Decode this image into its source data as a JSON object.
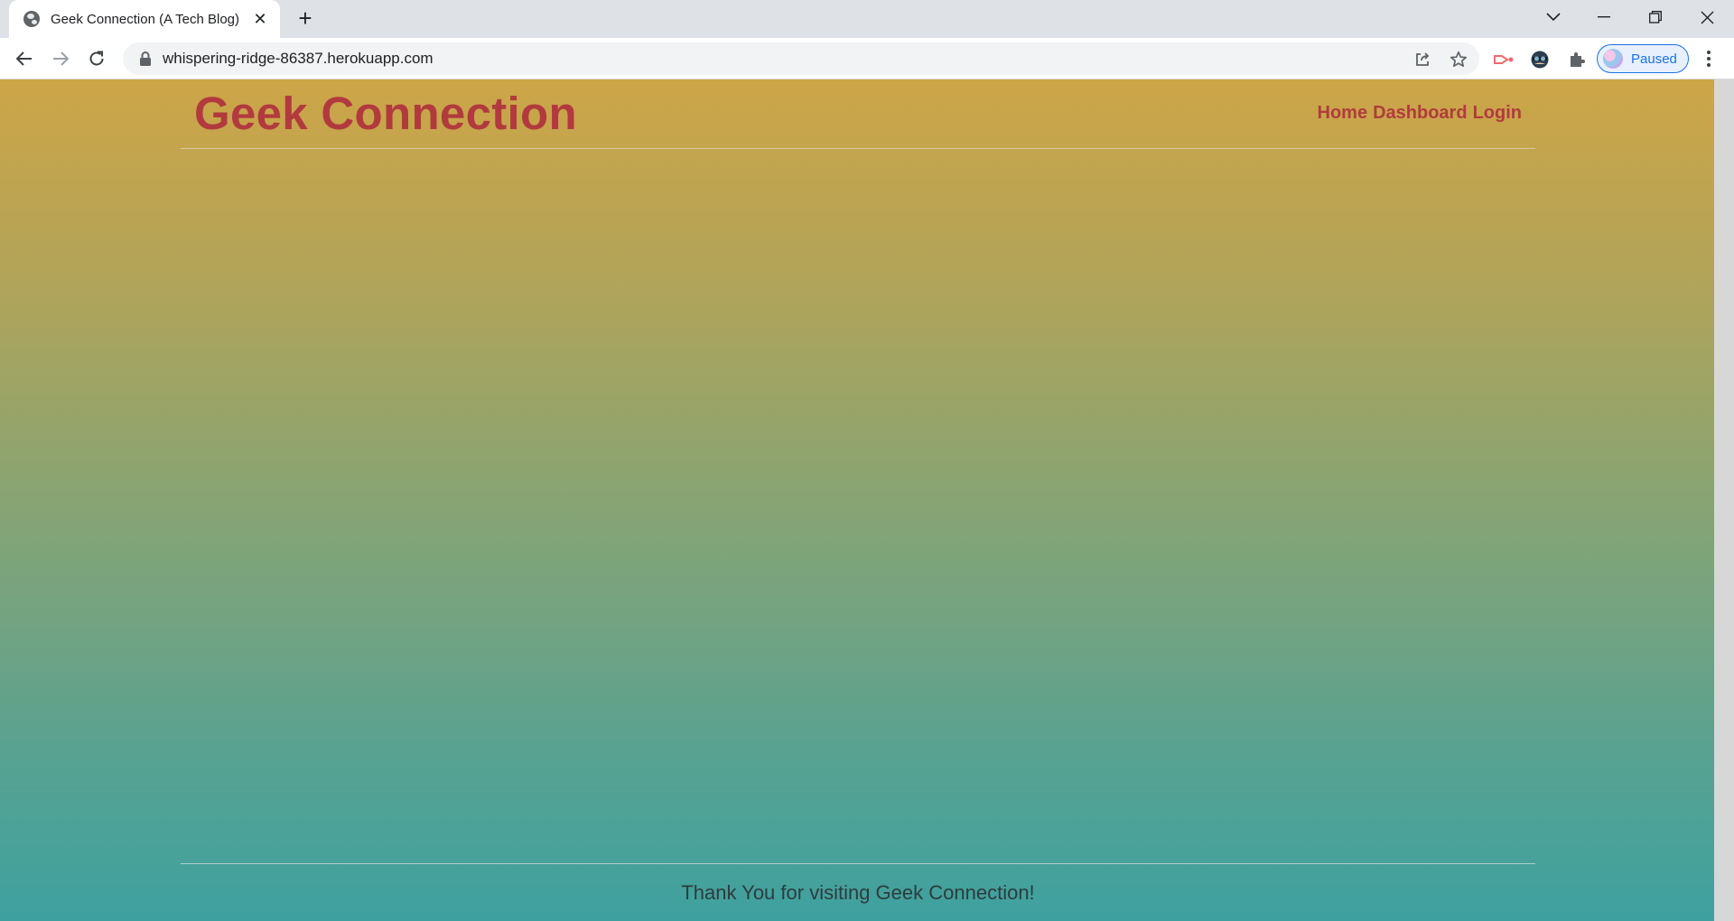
{
  "browser": {
    "tab": {
      "title": "Geek Connection (A Tech Blog)",
      "favicon": "globe-icon",
      "close_icon": "close-icon"
    },
    "new_tab_icon": "plus-icon",
    "window_controls": [
      "chevron-down-icon",
      "minimize-icon",
      "restore-icon",
      "close-icon"
    ],
    "toolbar": {
      "back_icon": "back-arrow-icon",
      "forward_icon": "forward-arrow-icon",
      "reload_icon": "reload-icon",
      "url": "whispering-ridge-86387.herokuapp.com",
      "share_icon": "share-icon",
      "bookmark_icon": "star-icon",
      "extensions": [
        "cast-extension-icon",
        "spy-extension-icon",
        "puzzle-icon"
      ],
      "profile_label": "Paused",
      "menu_icon": "kebab-menu-icon"
    }
  },
  "page": {
    "site_title": "Geek Connection",
    "nav": {
      "home": "Home",
      "dashboard": "Dashboard",
      "login": "Login"
    },
    "footer_text": "Thank You for visiting Geek Connection!",
    "colors": {
      "brand_red": "#b23a3f",
      "gradient_top": "#cda547",
      "gradient_bottom": "#3ea19f",
      "footer_text": "#2f3b3d"
    }
  }
}
